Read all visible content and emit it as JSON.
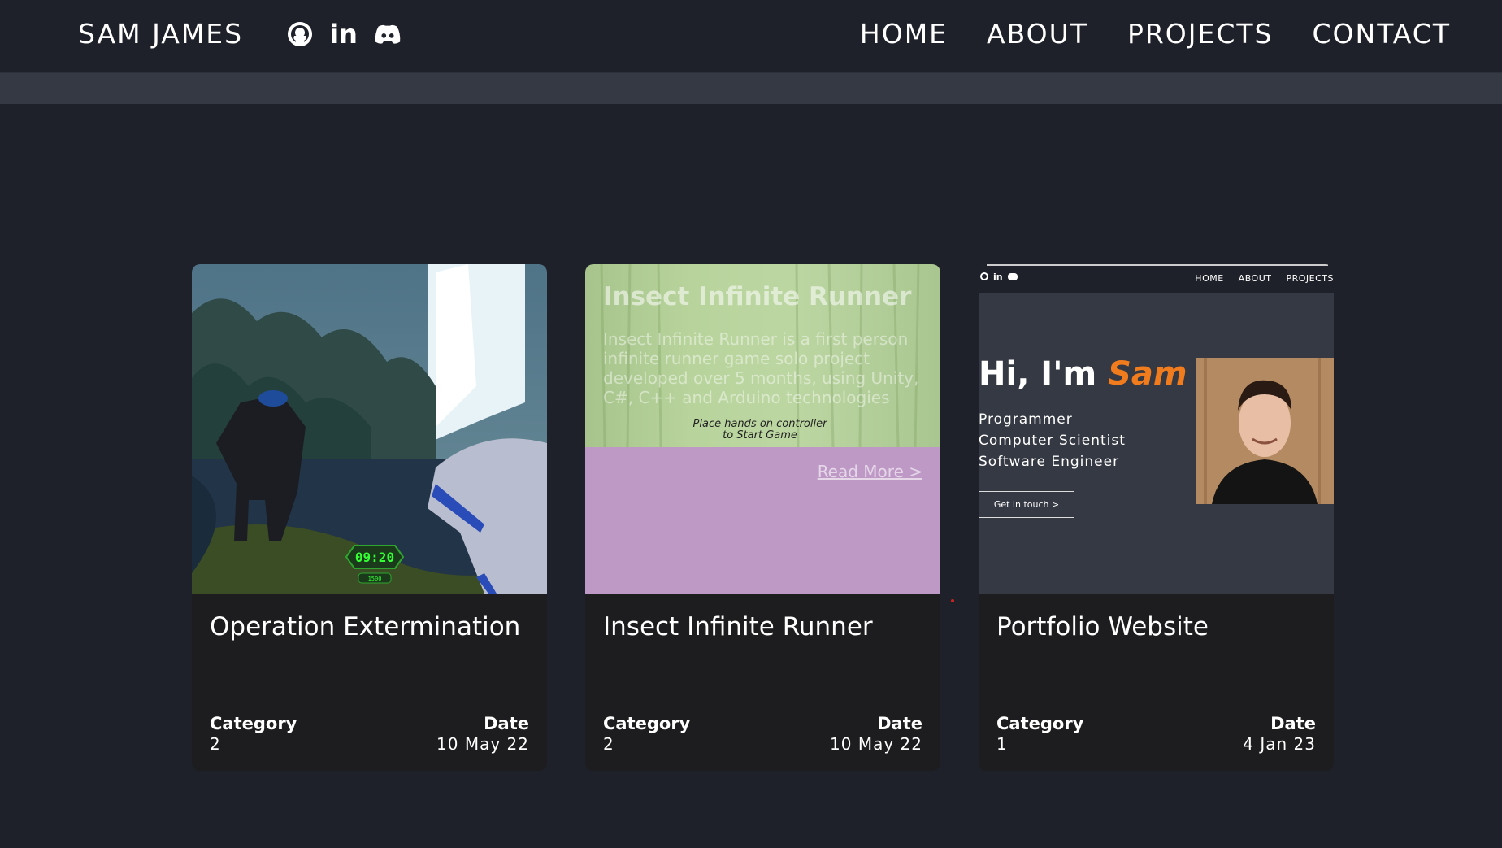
{
  "header": {
    "brand": "SAM JAMES",
    "socials": [
      "github-icon",
      "linkedin-icon",
      "discord-icon"
    ],
    "nav": [
      "HOME",
      "ABOUT",
      "PROJECTS",
      "CONTACT"
    ]
  },
  "projects": [
    {
      "title": "Operation Extermination",
      "category_label": "Category",
      "category": "2",
      "date_label": "Date",
      "date": "10 May 22",
      "hud_timer": "09:20",
      "hud_score": "1500"
    },
    {
      "title": "Insect Infinite Runner",
      "category_label": "Category",
      "category": "2",
      "date_label": "Date",
      "date": "10 May 22",
      "overlay_title": "Insect Infinite Runner",
      "overlay_desc": "Insect Infinite Runner is a first person infinite runner game solo project developed over 5 months, using Unity, C#, C++ and Arduino technologies",
      "overlay_hint": "Place hands on controller to Start Game",
      "read_more": "Read More >"
    },
    {
      "title": "Portfolio Website",
      "category_label": "Category",
      "category": "1",
      "date_label": "Date",
      "date": "4 Jan 23",
      "preview_nav": [
        "HOME",
        "ABOUT",
        "PROJECTS"
      ],
      "preview_greeting": "Hi, I'm",
      "preview_name": "Sam",
      "preview_roles": [
        "Programmer",
        "Computer Scientist",
        "Software Engineer"
      ],
      "preview_cta": "Get in touch >"
    }
  ],
  "colors": {
    "background": "#1e2129",
    "subbar": "#353943",
    "card": "#1d1d1f",
    "accent": "#f07c1e"
  }
}
